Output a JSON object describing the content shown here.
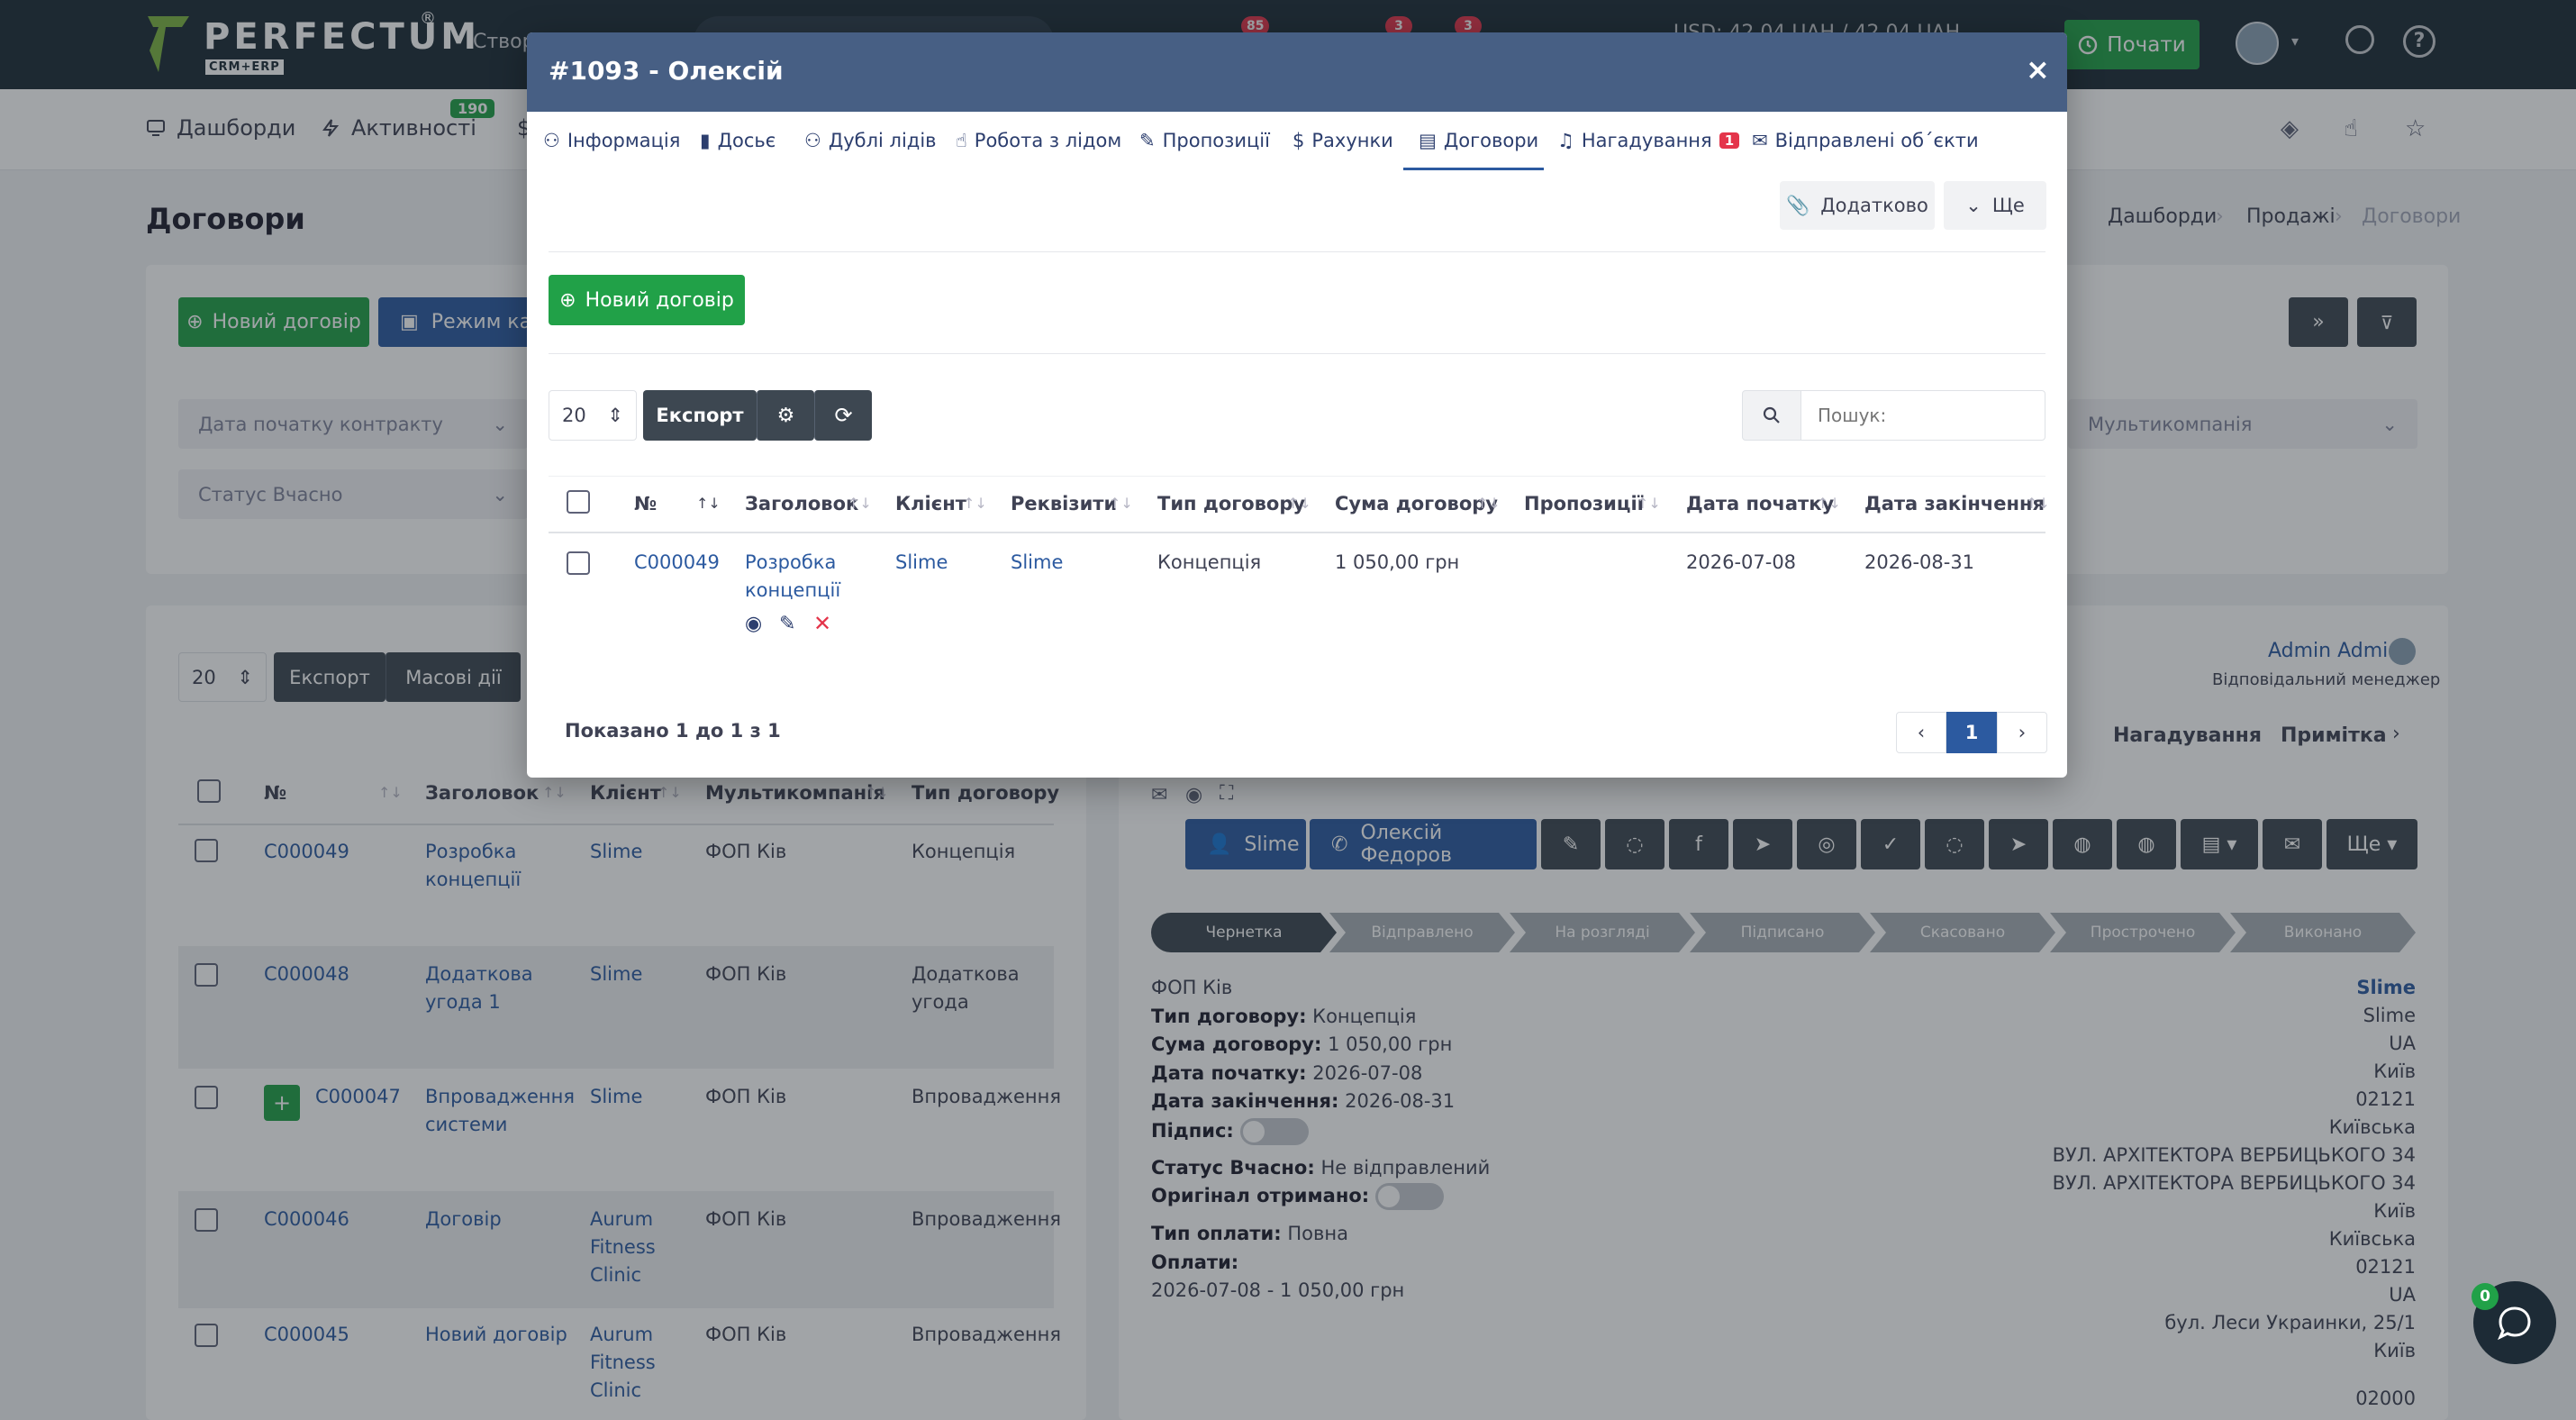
{
  "topbar": {
    "brand": "PERFECTUM",
    "brand_sub": "CRM+ERP",
    "reg_mark": "®",
    "create_label": "Створ",
    "badges": [
      "85",
      "3",
      "3"
    ],
    "currency": "USD: 42,04 UAH / 42,04 UAH",
    "start_label": "Почати"
  },
  "subnav": {
    "dashboards": "Дашборди",
    "activities": "Активності",
    "activities_badge": "190",
    "money_partial": "$"
  },
  "page": {
    "title": "Договори",
    "breadcrumb": [
      "Дашборди",
      "Продажі",
      "Договори"
    ]
  },
  "filters": {
    "new_contract": "Новий договір",
    "kanban": "Режим кан",
    "contract_start_date": "Дата початку контракту",
    "vchasno_status": "Статус Вчасно",
    "multicompany": "Мультикомпанія"
  },
  "list": {
    "page_size": "20",
    "export": "Експорт",
    "bulk": "Масові дії",
    "columns": [
      "№",
      "Заголовок",
      "Клієнт",
      "Мультикомпанія",
      "Тип договору"
    ],
    "rows": [
      {
        "num": "C000049",
        "title1": "Розробка",
        "title2": "концепції",
        "title3": "",
        "client1": "Slime",
        "client2": "",
        "client3": "",
        "company": "ФОП Ків",
        "type1": "Концепція",
        "type2": ""
      },
      {
        "num": "C000048",
        "title1": "Додаткова",
        "title2": "угода 1",
        "title3": "",
        "client1": "Slime",
        "client2": "",
        "client3": "",
        "company": "ФОП Ків",
        "type1": "Додаткова",
        "type2": "угода"
      },
      {
        "num": "C000047",
        "title1": "Впровадження",
        "title2": "системи",
        "title3": "",
        "client1": "Slime",
        "client2": "",
        "client3": "",
        "company": "ФОП Ків",
        "type1": "Впровадження",
        "type2": ""
      },
      {
        "num": "C000046",
        "title1": "Договір",
        "title2": "",
        "title3": "",
        "client1": "Aurum",
        "client2": "Fitness",
        "client3": "Clinic",
        "company": "ФОП Ків",
        "type1": "Впровадження",
        "type2": ""
      },
      {
        "num": "C000045",
        "title1": "Новий договір",
        "title2": "",
        "title3": "",
        "client1": "Aurum",
        "client2": "Fitness",
        "client3": "Clinic",
        "company": "ФОП Ків",
        "type1": "Впровадження",
        "type2": ""
      }
    ],
    "plus": "+"
  },
  "detail": {
    "manager_name": "Admin Admin",
    "manager_role": "Відповідальний менеджер",
    "tab_reminders": "Нагадування",
    "tab_note": "Примітка",
    "client_btn": "Slime",
    "contact_btn": "Олексій Федоров",
    "more_btn": "Ще",
    "stages": [
      "Чернетка",
      "Відправлено",
      "На розгляді",
      "Підписано",
      "Скасовано",
      "Прострочено",
      "Виконано"
    ],
    "company": "ФОП Ків",
    "type_label": "Тип договору:",
    "type_value": "Концепція",
    "sum_label": "Сума договору:",
    "sum_value": "1 050,00 грн",
    "start_label": "Дата початку:",
    "start_value": "2026-07-08",
    "end_label": "Дата закінчення:",
    "end_value": "2026-08-31",
    "sign_label": "Підпис:",
    "vchasno_label": "Статус Вчасно:",
    "vchasno_value": "Не відправлений",
    "original_label": "Оригінал отримано:",
    "payment_type_label": "Тип оплати:",
    "payment_type_value": "Повна",
    "payments_label": "Оплати:",
    "payment_line": "2026-07-08 - 1 050,00 грн",
    "right_lines": [
      "Slime",
      "Slime",
      "UA",
      "Київ",
      "02121",
      "Київська",
      "ВУЛ. АРХІТЕКТОРА ВЕРБИЦЬКОГО 34",
      "ВУЛ. АРХІТЕКТОРА ВЕРБИЦЬКОГО 34",
      "Київ",
      "Київська",
      "02121",
      "UA",
      "бул. Леси Украинки, 25/1",
      "Київ",
      "02000"
    ]
  },
  "modal": {
    "title": "#1093 - Олексій",
    "close": "×",
    "tabs": [
      "Інформація",
      "Досьє",
      "Дублі лідів",
      "Робота з лідом",
      "Пропозиції",
      "Рахунки",
      "Договори",
      "Нагадування",
      "Відправлені об΄єкти"
    ],
    "reminders_badge": "1",
    "additional": "Додатково",
    "more": "Ще",
    "new_contract": "Новий договір",
    "page_size": "20",
    "export": "Експорт",
    "search_placeholder": "Пошук:",
    "columns": [
      "№",
      "Заголовок",
      "Клієнт",
      "Реквізити",
      "Тип договору",
      "Сума договору",
      "Пропозиції",
      "Дата початку",
      "Дата закінчення"
    ],
    "row": {
      "num": "C000049",
      "title1": "Розробка",
      "title2": "концепції",
      "client": "Slime",
      "requisites": "Slime",
      "type": "Концепція",
      "sum": "1 050,00 грн",
      "offers": "",
      "start": "2026-07-08",
      "end": "2026-08-31"
    },
    "showing": "Показано 1 до 1 з 1",
    "page_current": "1"
  },
  "chat": {
    "badge": "0"
  },
  "colors": {
    "green": "#21a148",
    "blue": "#2c5aa0",
    "dark": "#1d2b36",
    "modal_head": "#475f84",
    "red": "#e4354b"
  }
}
